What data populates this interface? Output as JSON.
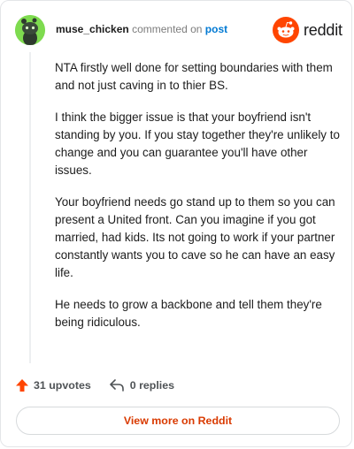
{
  "header": {
    "username": "muse_chicken",
    "action_text": "commented on",
    "post_link": "post"
  },
  "brand": {
    "wordmark": "reddit",
    "color": "#ff4500"
  },
  "comment": {
    "paragraphs": [
      "NTA firstly well done for setting boundaries with them and not just caving in to thier BS.",
      "I think the bigger issue is that your boyfriend isn't standing by you. If you stay together they're unlikely to change and you can guarantee you'll have other issues.",
      "Your boyfriend needs go stand up to them so you can present a United front. Can you imagine if you got married, had kids. Its not going to work if your partner constantly wants you to cave so he can have an easy life.",
      "He needs to grow a backbone and tell them they're being ridiculous."
    ]
  },
  "footer": {
    "upvotes": "31 upvotes",
    "replies": "0 replies"
  },
  "view_more": "View more on Reddit",
  "colors": {
    "avatar_bg": "#7edb4f",
    "upvote": "#ff4500",
    "link": "#0079d3",
    "cta": "#d93a00"
  },
  "icons": [
    "snoo-avatar-icon",
    "reddit-logo-icon",
    "upvote-arrow-icon",
    "reply-arrow-icon"
  ]
}
